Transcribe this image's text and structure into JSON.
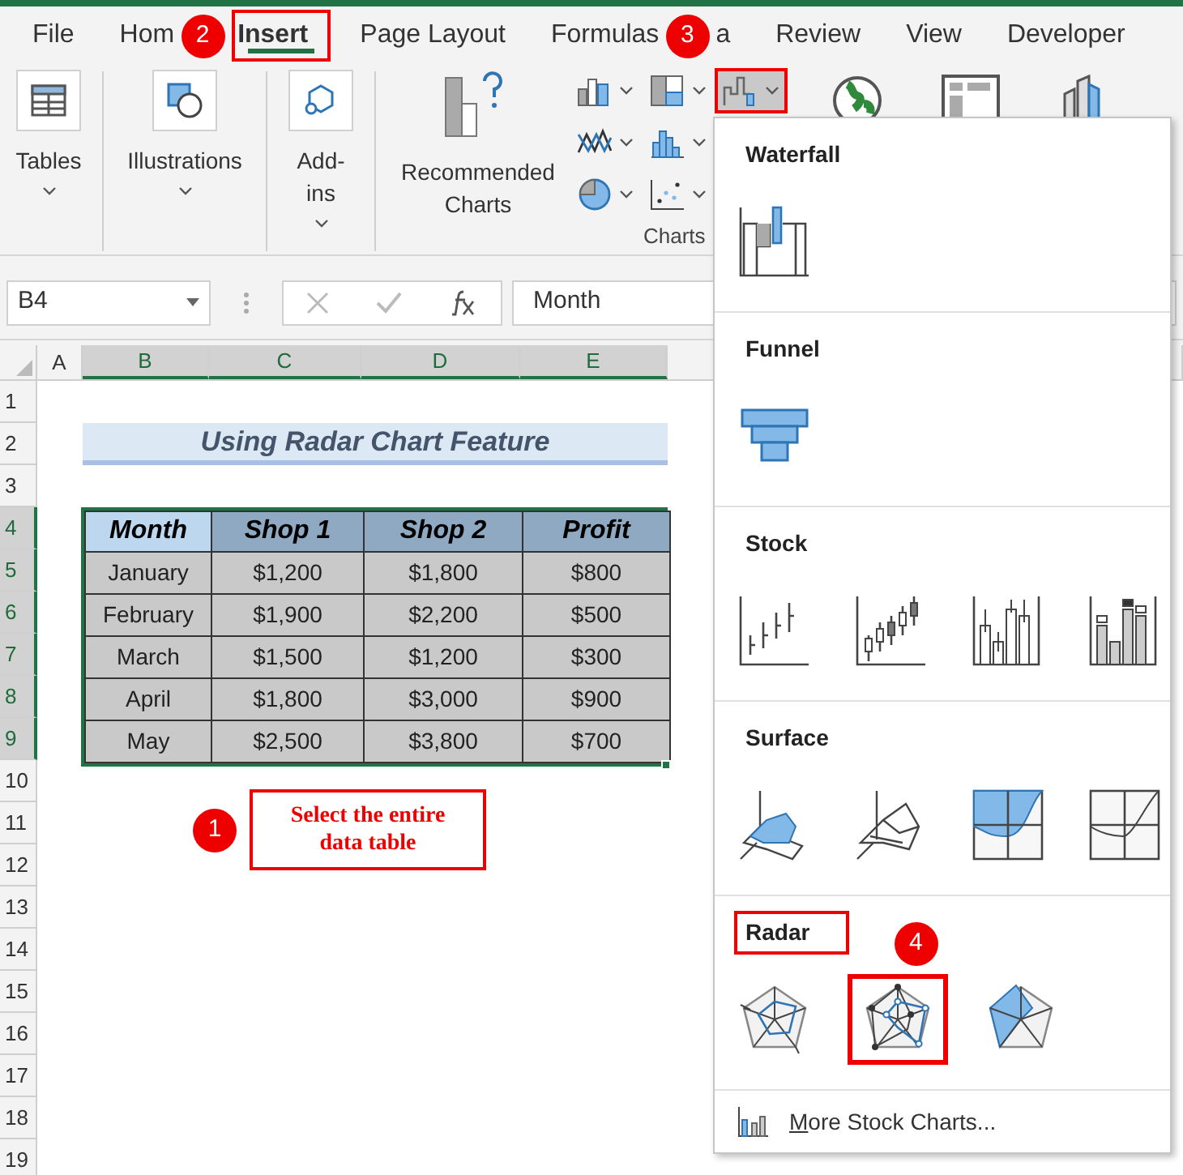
{
  "tabs": [
    {
      "kind": "tab",
      "label": "File",
      "selected": false,
      "highlighted": false
    },
    {
      "kind": "tab",
      "label": "Hom",
      "selected": false,
      "highlighted": false
    },
    {
      "kind": "step",
      "label": "2"
    },
    {
      "kind": "tab",
      "label": "Insert",
      "selected": true,
      "highlighted": true
    },
    {
      "kind": "tab",
      "label": "Page Layout",
      "selected": false,
      "highlighted": false
    },
    {
      "kind": "tab",
      "label": "Formulas",
      "selected": false,
      "highlighted": false
    },
    {
      "kind": "step",
      "label": "3"
    },
    {
      "kind": "tab",
      "label": "a",
      "selected": false,
      "highlighted": false
    },
    {
      "kind": "tab",
      "label": "Review",
      "selected": false,
      "highlighted": false
    },
    {
      "kind": "tab",
      "label": "View",
      "selected": false,
      "highlighted": false
    },
    {
      "kind": "tab",
      "label": "Developer",
      "selected": false,
      "highlighted": false
    }
  ],
  "ribbon": {
    "buttons": [
      {
        "kind": "tables",
        "label": "Tables"
      },
      {
        "kind": "illustrations",
        "label": "Illustrations"
      },
      {
        "kind": "addins",
        "label": "Add-ins"
      },
      {
        "kind": "recommended",
        "label": "Recommended Charts"
      }
    ],
    "chart_buttons": [
      {
        "kind": "column",
        "selected": false,
        "highlighted": false
      },
      {
        "kind": "line",
        "selected": false,
        "highlighted": false
      },
      {
        "kind": "pie",
        "selected": false,
        "highlighted": false
      },
      {
        "kind": "hierarchy",
        "selected": false,
        "highlighted": false
      },
      {
        "kind": "statistic",
        "selected": false,
        "highlighted": false
      },
      {
        "kind": "scatter",
        "selected": false,
        "highlighted": false
      },
      {
        "kind": "waterfall",
        "selected": true,
        "highlighted": true
      }
    ],
    "group_label": "Charts",
    "extra_buttons": [
      {
        "kind": "maps"
      },
      {
        "kind": "pivot"
      },
      {
        "kind": "map3d"
      }
    ]
  },
  "formula_bar": {
    "name_box": "B4",
    "formula": "Month"
  },
  "sheet": {
    "columns": [
      {
        "label": "A",
        "selected": false
      },
      {
        "label": "B",
        "selected": true
      },
      {
        "label": "C",
        "selected": true
      },
      {
        "label": "D",
        "selected": true
      },
      {
        "label": "E",
        "selected": true
      }
    ],
    "rows": [
      {
        "label": "1",
        "selected": false
      },
      {
        "label": "2",
        "selected": false
      },
      {
        "label": "3",
        "selected": false
      },
      {
        "label": "4",
        "selected": true
      },
      {
        "label": "5",
        "selected": true
      },
      {
        "label": "6",
        "selected": true
      },
      {
        "label": "7",
        "selected": true
      },
      {
        "label": "8",
        "selected": true
      },
      {
        "label": "9",
        "selected": true
      },
      {
        "label": "10",
        "selected": false
      },
      {
        "label": "11",
        "selected": false
      },
      {
        "label": "12",
        "selected": false
      },
      {
        "label": "13",
        "selected": false
      },
      {
        "label": "14",
        "selected": false
      },
      {
        "label": "15",
        "selected": false
      },
      {
        "label": "16",
        "selected": false
      },
      {
        "label": "17",
        "selected": false
      },
      {
        "label": "18",
        "selected": false
      },
      {
        "label": "19",
        "selected": false
      }
    ],
    "title": "Using Radar Chart Feature",
    "table": {
      "columns": [
        {
          "label": "Month",
          "selected": true
        },
        {
          "label": "Shop 1",
          "selected": false
        },
        {
          "label": "Shop 2",
          "selected": false
        },
        {
          "label": "Profit",
          "selected": false
        }
      ],
      "rows": [
        [
          "January",
          "$1,200",
          "$1,800",
          "$800"
        ],
        [
          "February",
          "$1,900",
          "$2,200",
          "$500"
        ],
        [
          "March",
          "$1,500",
          "$1,200",
          "$300"
        ],
        [
          "April",
          "$1,800",
          "$3,000",
          "$900"
        ],
        [
          "May",
          "$2,500",
          "$3,800",
          "$700"
        ]
      ]
    },
    "callout": {
      "step": "1",
      "text": "Select the entire data table"
    }
  },
  "gallery": {
    "sections": [
      {
        "title": "Waterfall",
        "highlighted": false,
        "items": [
          {
            "kind": "waterfall",
            "highlighted": false
          }
        ]
      },
      {
        "title": "Funnel",
        "highlighted": false,
        "items": [
          {
            "kind": "funnel",
            "highlighted": false
          }
        ]
      },
      {
        "title": "Stock",
        "highlighted": false,
        "items": [
          {
            "kind": "stock-hlc",
            "highlighted": false
          },
          {
            "kind": "stock-ohlc",
            "highlighted": false
          },
          {
            "kind": "stock-vhlc",
            "highlighted": false
          },
          {
            "kind": "stock-vohlc",
            "highlighted": false
          }
        ]
      },
      {
        "title": "Surface",
        "highlighted": false,
        "items": [
          {
            "kind": "surface-3d",
            "highlighted": false
          },
          {
            "kind": "surface-wire",
            "highlighted": false
          },
          {
            "kind": "contour",
            "highlighted": false
          },
          {
            "kind": "contour-wire",
            "highlighted": false
          }
        ]
      },
      {
        "title": "Radar",
        "highlighted": true,
        "step": "4",
        "items": [
          {
            "kind": "radar",
            "highlighted": false
          },
          {
            "kind": "radar-markers",
            "highlighted": true
          },
          {
            "kind": "radar-filled",
            "highlighted": false
          }
        ]
      }
    ],
    "footer": "More Stock Charts..."
  }
}
